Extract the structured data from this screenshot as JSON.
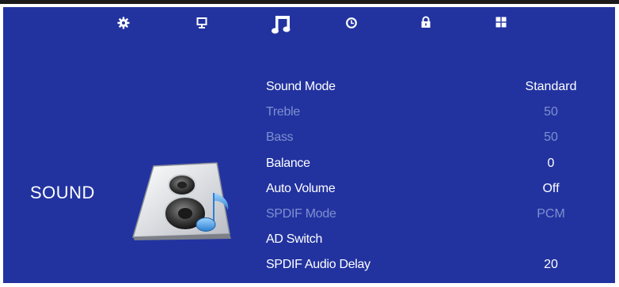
{
  "colors": {
    "background": "#2233a0",
    "text": "#ffffff",
    "disabled_text": "#7e8fd0",
    "accent": "#4da3e0"
  },
  "tabs": [
    {
      "icon": "gear-icon",
      "name": "settings"
    },
    {
      "icon": "monitor-icon",
      "name": "picture"
    },
    {
      "icon": "music-note-icon",
      "name": "sound",
      "selected": true
    },
    {
      "icon": "clock-icon",
      "name": "time"
    },
    {
      "icon": "lock-icon",
      "name": "lock"
    },
    {
      "icon": "grid-icon",
      "name": "apps"
    }
  ],
  "menu": {
    "title": "SOUND",
    "icon": "speaker-music-icon"
  },
  "items": [
    {
      "label": "Sound Mode",
      "value": "Standard",
      "enabled": true
    },
    {
      "label": "Treble",
      "value": "50",
      "enabled": false
    },
    {
      "label": "Bass",
      "value": "50",
      "enabled": false
    },
    {
      "label": "Balance",
      "value": "0",
      "enabled": true
    },
    {
      "label": "Auto Volume",
      "value": "Off",
      "enabled": true
    },
    {
      "label": "SPDIF Mode",
      "value": "PCM",
      "enabled": false
    },
    {
      "label": "AD Switch",
      "value": "",
      "enabled": true
    },
    {
      "label": "SPDIF Audio Delay",
      "value": "20",
      "enabled": true
    }
  ]
}
